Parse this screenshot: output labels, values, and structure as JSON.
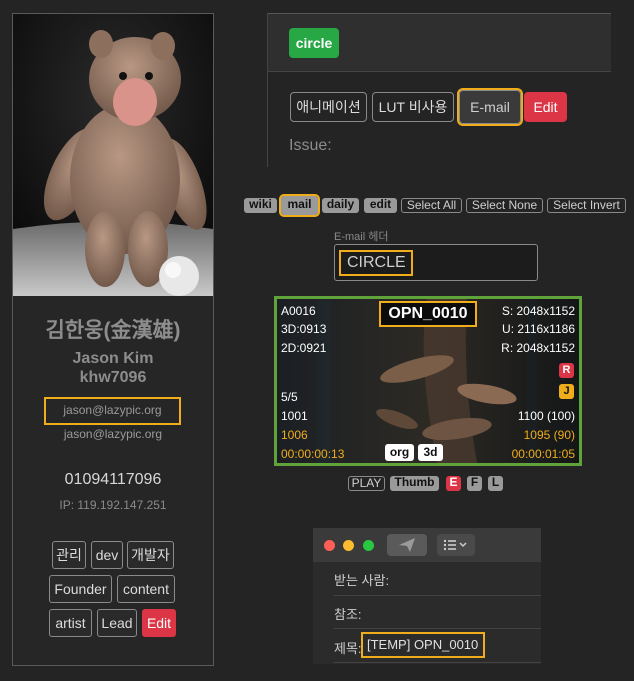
{
  "profile": {
    "name_ko": "김한웅(金漢雄)",
    "name_en": "Jason Kim",
    "user_id": "khw7096",
    "email_primary": "jason@lazypic.org",
    "email_secondary": "jason@lazypic.org",
    "phone": "01094117096",
    "ip": "IP: 119.192.147.251",
    "tags": [
      "관리",
      "dev",
      "개발자",
      "Founder",
      "content",
      "artist",
      "Lead"
    ],
    "edit_label": "Edit"
  },
  "panel": {
    "status_badge": "circle",
    "buttons": [
      "애니메이션",
      "LUT 비사용",
      "E-mail"
    ],
    "edit_label": "Edit",
    "issue_label": "Issue:"
  },
  "toolbar": {
    "items": [
      "wiki",
      "mail",
      "daily",
      "edit"
    ],
    "select_all": "Select All",
    "select_none": "Select None",
    "select_invert": "Select Invert"
  },
  "email_header": {
    "label": "E-mail 헤더",
    "value": "CIRCLE"
  },
  "video": {
    "shot_name": "OPN_0010",
    "top_left": [
      "A0016",
      "3D:0913",
      "2D:0921"
    ],
    "top_right": [
      "S: 2048x1152",
      "U: 2116x1186",
      "R: 2048x1152"
    ],
    "badge_r": "R",
    "badge_j": "J",
    "count": "5/5",
    "frame_left": "1001",
    "frame_left_sub": "1006",
    "timecode_left": "00:00:00:13",
    "frame_right": "1100 (100)",
    "frame_right_sub": "1095 (90)",
    "timecode_right": "00:00:01:05",
    "tag_org": "org",
    "tag_3d": "3d"
  },
  "player": {
    "play": "PLAY",
    "thumb": "Thumb",
    "e": "E",
    "f": "F",
    "l": "L"
  },
  "mail": {
    "to_label": "받는 사람:",
    "cc_label": "참조:",
    "subject_label": "제목:",
    "subject_value": "[TEMP] OPN_0010"
  },
  "colors": {
    "accent_red": "#dc3545",
    "accent_green": "#28a745",
    "highlight": "#f0ad1b",
    "video_border": "#5fa33a"
  }
}
